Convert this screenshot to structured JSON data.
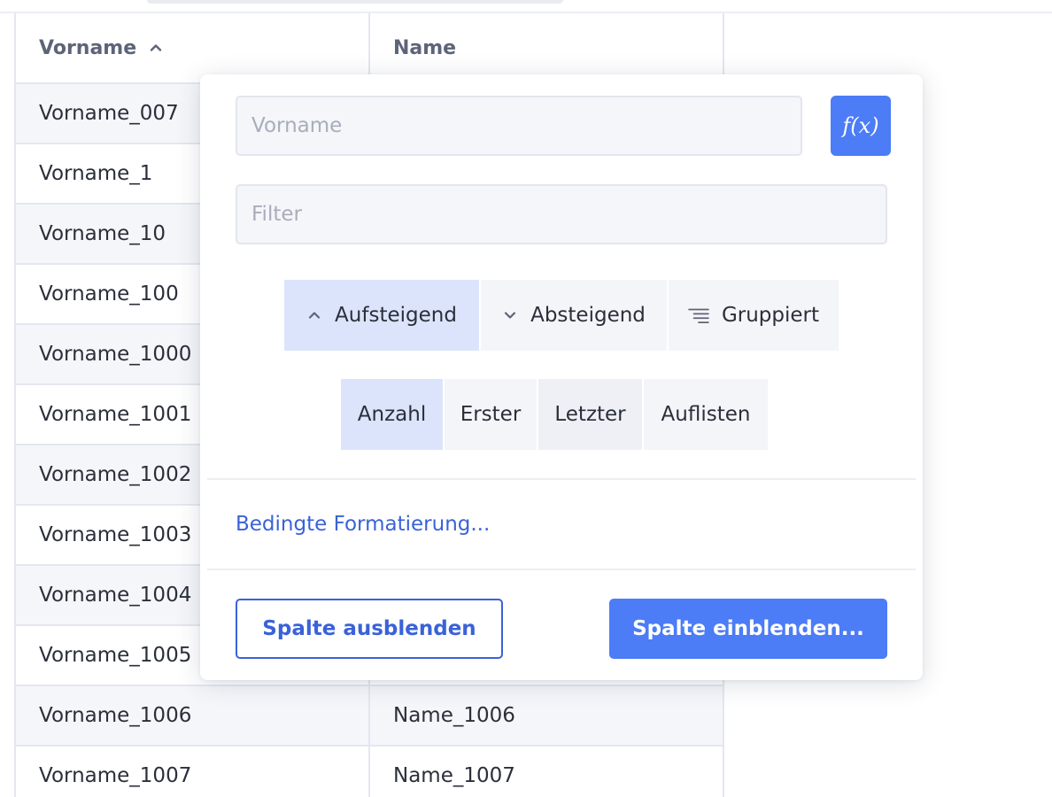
{
  "grid": {
    "columns": [
      {
        "label": "Vorname",
        "sort_icon": "chevron-up-icon"
      },
      {
        "label": "Name"
      }
    ],
    "rows": [
      {
        "vorname": "Vorname_007",
        "name": ""
      },
      {
        "vorname": "Vorname_1",
        "name": ""
      },
      {
        "vorname": "Vorname_10",
        "name": ""
      },
      {
        "vorname": "Vorname_100",
        "name": ""
      },
      {
        "vorname": "Vorname_1000",
        "name": ""
      },
      {
        "vorname": "Vorname_1001",
        "name": ""
      },
      {
        "vorname": "Vorname_1002",
        "name": ""
      },
      {
        "vorname": "Vorname_1003",
        "name": ""
      },
      {
        "vorname": "Vorname_1004",
        "name": ""
      },
      {
        "vorname": "Vorname_1005",
        "name": ""
      },
      {
        "vorname": "Vorname_1006",
        "name": "Name_1006"
      },
      {
        "vorname": "Vorname_1007",
        "name": "Name_1007"
      }
    ]
  },
  "popup": {
    "name_field": {
      "value": "",
      "placeholder": "Vorname"
    },
    "fx_button": {
      "label": "f(x)"
    },
    "filter_field": {
      "value": "",
      "placeholder": "Filter"
    },
    "sort_options": [
      {
        "label": "Aufsteigend",
        "icon": "chevron-up-icon",
        "active": true
      },
      {
        "label": "Absteigend",
        "icon": "chevron-down-icon",
        "active": false
      },
      {
        "label": "Gruppiert",
        "icon": "group-lines-icon",
        "active": false
      }
    ],
    "aggregate_options": [
      {
        "label": "Anzahl",
        "active": true
      },
      {
        "label": "Erster",
        "active": false
      },
      {
        "label": "Letzter",
        "active": false
      },
      {
        "label": "Auflisten",
        "active": false
      }
    ],
    "conditional_formatting_label": "Bedingte Formatierung...",
    "hide_column_label": "Spalte ausblenden",
    "show_column_label": "Spalte einblenden..."
  },
  "colors": {
    "accent": "#4c7cf6",
    "link": "#3a62d8",
    "active_segment": "#dbe4fb"
  }
}
